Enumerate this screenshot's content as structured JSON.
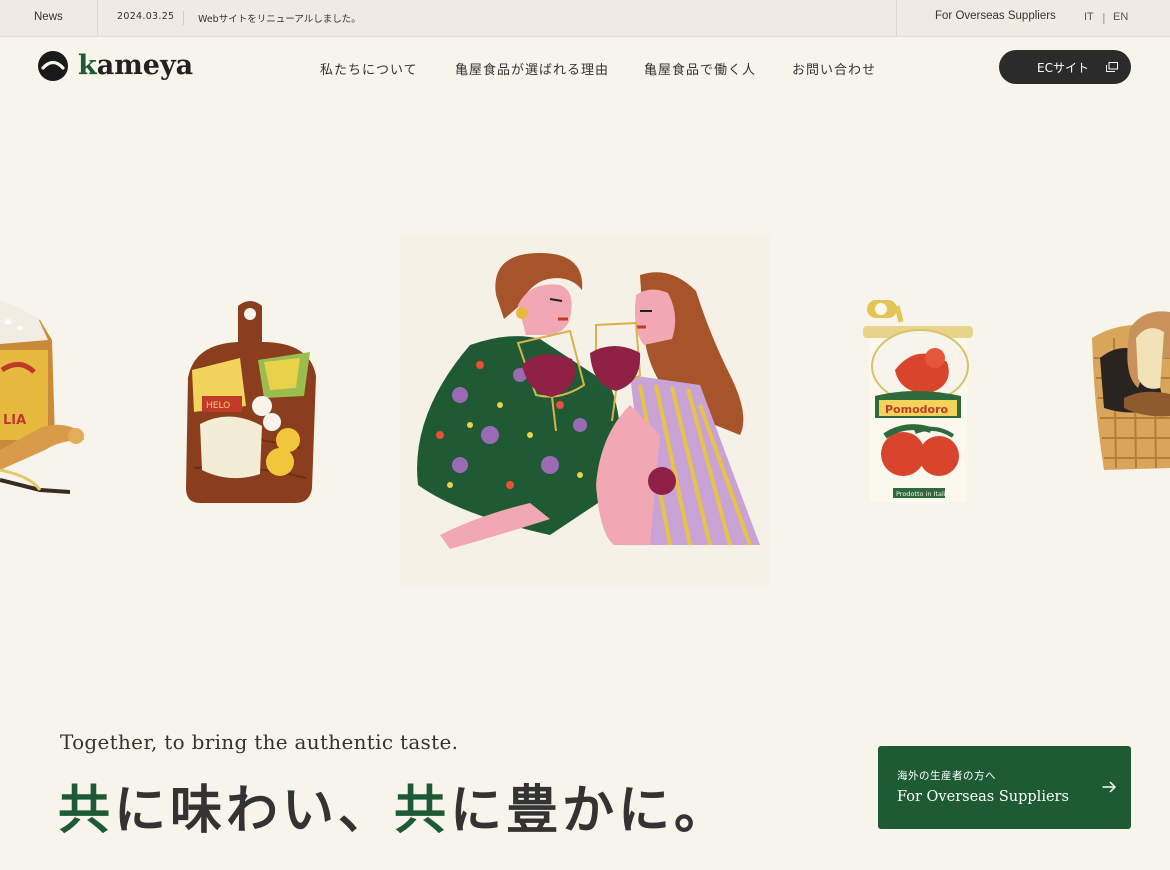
{
  "topbar": {
    "news_label": "News",
    "date": "2024.03.25",
    "headline": "Webサイトをリニューアルしました。",
    "overseas_link": "For Overseas Suppliers",
    "lang_it": "IT",
    "lang_sep": "|",
    "lang_en": "EN"
  },
  "header": {
    "logo_k": "k",
    "logo_rest": "ameya",
    "nav": [
      {
        "label": "私たちについて"
      },
      {
        "label": "亀屋食品が選ばれる理由"
      },
      {
        "label": "亀屋食品で働く人"
      },
      {
        "label": "お問い合わせ"
      }
    ],
    "ec_button": "ECサイト"
  },
  "illustrations": {
    "can_label": "Pomodoro",
    "can_sublabel": "Prodotto in Italia",
    "bag_label": "LIA",
    "board_label": "HELO"
  },
  "hero": {
    "tagline_en": "Together, to bring the authentic taste.",
    "tagline_jp_1": "共",
    "tagline_jp_2": "に味わい、",
    "tagline_jp_3": "共",
    "tagline_jp_4": "に豊かに。",
    "cta_sub": "海外の生産者の方へ",
    "cta_main": "For Overseas Suppliers"
  },
  "colors": {
    "background": "#f7f4ec",
    "brand_green": "#1e5b35",
    "dark": "#2b2b2b"
  }
}
